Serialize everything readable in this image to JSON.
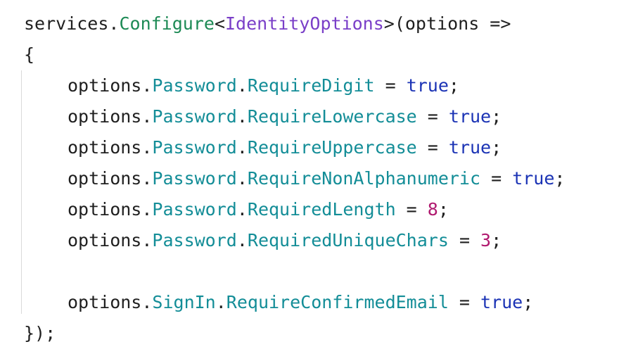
{
  "editor": {
    "lines": [
      {
        "indent": 0,
        "tokens": [
          {
            "text": "services.",
            "kind": "plain"
          },
          {
            "text": "Configure",
            "kind": "method"
          },
          {
            "text": "<",
            "kind": "plain"
          },
          {
            "text": "IdentityOptions",
            "kind": "type"
          },
          {
            "text": ">(options =>",
            "kind": "plain"
          }
        ]
      },
      {
        "indent": 0,
        "tokens": [
          {
            "text": "{",
            "kind": "plain"
          }
        ]
      },
      {
        "indent": 1,
        "tokens": [
          {
            "text": "options.",
            "kind": "plain"
          },
          {
            "text": "Password",
            "kind": "prop"
          },
          {
            "text": ".",
            "kind": "plain"
          },
          {
            "text": "RequireDigit",
            "kind": "prop"
          },
          {
            "text": " = ",
            "kind": "plain"
          },
          {
            "text": "true",
            "kind": "keyword"
          },
          {
            "text": ";",
            "kind": "plain"
          }
        ]
      },
      {
        "indent": 1,
        "tokens": [
          {
            "text": "options.",
            "kind": "plain"
          },
          {
            "text": "Password",
            "kind": "prop"
          },
          {
            "text": ".",
            "kind": "plain"
          },
          {
            "text": "RequireLowercase",
            "kind": "prop"
          },
          {
            "text": " = ",
            "kind": "plain"
          },
          {
            "text": "true",
            "kind": "keyword"
          },
          {
            "text": ";",
            "kind": "plain"
          }
        ]
      },
      {
        "indent": 1,
        "tokens": [
          {
            "text": "options.",
            "kind": "plain"
          },
          {
            "text": "Password",
            "kind": "prop"
          },
          {
            "text": ".",
            "kind": "plain"
          },
          {
            "text": "RequireUppercase",
            "kind": "prop"
          },
          {
            "text": " = ",
            "kind": "plain"
          },
          {
            "text": "true",
            "kind": "keyword"
          },
          {
            "text": ";",
            "kind": "plain"
          }
        ]
      },
      {
        "indent": 1,
        "tokens": [
          {
            "text": "options.",
            "kind": "plain"
          },
          {
            "text": "Password",
            "kind": "prop"
          },
          {
            "text": ".",
            "kind": "plain"
          },
          {
            "text": "RequireNonAlphanumeric",
            "kind": "prop"
          },
          {
            "text": " = ",
            "kind": "plain"
          },
          {
            "text": "true",
            "kind": "keyword"
          },
          {
            "text": ";",
            "kind": "plain"
          }
        ]
      },
      {
        "indent": 1,
        "tokens": [
          {
            "text": "options.",
            "kind": "plain"
          },
          {
            "text": "Password",
            "kind": "prop"
          },
          {
            "text": ".",
            "kind": "plain"
          },
          {
            "text": "RequiredLength",
            "kind": "prop"
          },
          {
            "text": " = ",
            "kind": "plain"
          },
          {
            "text": "8",
            "kind": "number"
          },
          {
            "text": ";",
            "kind": "plain"
          }
        ]
      },
      {
        "indent": 1,
        "tokens": [
          {
            "text": "options.",
            "kind": "plain"
          },
          {
            "text": "Password",
            "kind": "prop"
          },
          {
            "text": ".",
            "kind": "plain"
          },
          {
            "text": "RequiredUniqueChars",
            "kind": "prop"
          },
          {
            "text": " = ",
            "kind": "plain"
          },
          {
            "text": "3",
            "kind": "number"
          },
          {
            "text": ";",
            "kind": "plain"
          }
        ]
      },
      {
        "indent": 0,
        "tokens": []
      },
      {
        "indent": 1,
        "tokens": [
          {
            "text": "options.",
            "kind": "plain"
          },
          {
            "text": "SignIn",
            "kind": "prop"
          },
          {
            "text": ".",
            "kind": "plain"
          },
          {
            "text": "RequireConfirmedEmail",
            "kind": "prop"
          },
          {
            "text": " = ",
            "kind": "plain"
          },
          {
            "text": "true",
            "kind": "keyword"
          },
          {
            "text": ";",
            "kind": "plain"
          }
        ]
      },
      {
        "indent": 0,
        "tokens": [
          {
            "text": "});",
            "kind": "plain"
          }
        ]
      }
    ]
  },
  "colors": {
    "background": "#ffffff",
    "plain": "#1f1f1f",
    "method": "#1d8a55",
    "type": "#7a3fc8",
    "property": "#138d97",
    "keyword": "#1b33b5",
    "number": "#b0196f",
    "indent_guide": "#d9d9d9"
  }
}
